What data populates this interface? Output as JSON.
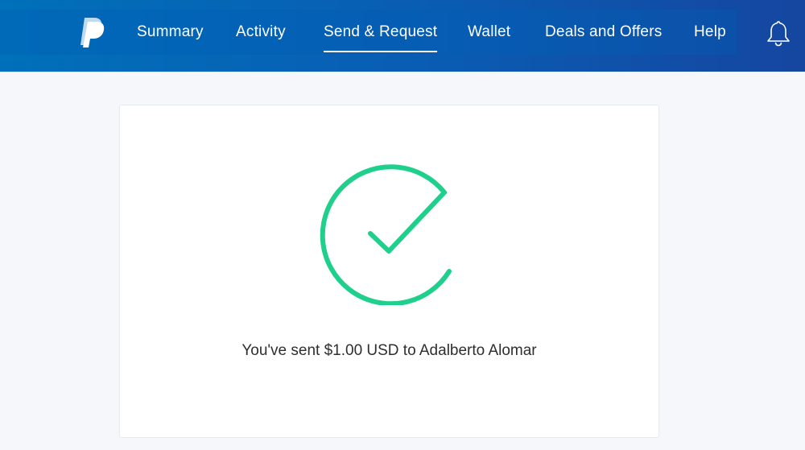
{
  "header": {
    "logo_icon": "paypal-logo-icon",
    "nav": [
      {
        "label": "Summary",
        "active": false
      },
      {
        "label": "Activity",
        "active": false
      },
      {
        "label": "Send & Request",
        "active": true
      },
      {
        "label": "Wallet",
        "active": false
      },
      {
        "label": "Deals and Offers",
        "active": false
      },
      {
        "label": "Help",
        "active": false
      }
    ],
    "notifications_icon": "bell-icon"
  },
  "confirmation": {
    "icon": "success-check-icon",
    "message": "You've sent $1.00 USD to Adalberto Alomar"
  },
  "colors": {
    "header_blue": "#0070ba",
    "header_blue_dark": "#1546a0",
    "success_green": "#1ed08c",
    "page_background": "#f5f7fa",
    "text": "#2c2e2f"
  }
}
